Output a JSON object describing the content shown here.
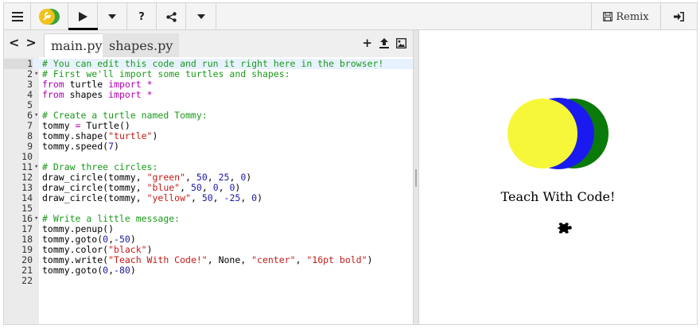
{
  "toolbar": {
    "remix_label": "Remix"
  },
  "editor": {
    "tabs": [
      {
        "label": "main.py"
      },
      {
        "label": "shapes.py"
      }
    ],
    "lines": [
      {
        "n": "1",
        "fold": "",
        "tokens": [
          [
            "c-com",
            "# You can edit this code and run it right here in the browser!"
          ]
        ]
      },
      {
        "n": "2",
        "fold": "▾",
        "tokens": [
          [
            "c-com",
            "# First we'll import some turtles and shapes:"
          ]
        ]
      },
      {
        "n": "3",
        "fold": "",
        "tokens": [
          [
            "c-kw",
            "from"
          ],
          [
            "",
            " turtle "
          ],
          [
            "c-kw",
            "import"
          ],
          [
            "",
            " "
          ],
          [
            "c-kw",
            "*"
          ]
        ]
      },
      {
        "n": "4",
        "fold": "",
        "tokens": [
          [
            "c-kw",
            "from"
          ],
          [
            "",
            " shapes "
          ],
          [
            "c-kw",
            "import"
          ],
          [
            "",
            " "
          ],
          [
            "c-kw",
            "*"
          ]
        ]
      },
      {
        "n": "5",
        "fold": "",
        "tokens": []
      },
      {
        "n": "6",
        "fold": "▾",
        "tokens": [
          [
            "c-com",
            "# Create a turtle named Tommy:"
          ]
        ]
      },
      {
        "n": "7",
        "fold": "",
        "tokens": [
          [
            "",
            "tommy "
          ],
          [
            "c-kw",
            "="
          ],
          [
            "",
            " Turtle()"
          ]
        ]
      },
      {
        "n": "8",
        "fold": "",
        "tokens": [
          [
            "",
            "tommy.shape("
          ],
          [
            "c-str",
            "\"turtle\""
          ],
          [
            "",
            ")"
          ]
        ]
      },
      {
        "n": "9",
        "fold": "",
        "tokens": [
          [
            "",
            "tommy.speed("
          ],
          [
            "c-num",
            "7"
          ],
          [
            "",
            ")"
          ]
        ]
      },
      {
        "n": "10",
        "fold": "",
        "tokens": []
      },
      {
        "n": "11",
        "fold": "▾",
        "tokens": [
          [
            "c-com",
            "# Draw three circles:"
          ]
        ]
      },
      {
        "n": "12",
        "fold": "",
        "tokens": [
          [
            "",
            "draw_circle(tommy, "
          ],
          [
            "c-str",
            "\"green\""
          ],
          [
            "",
            ", "
          ],
          [
            "c-num",
            "50"
          ],
          [
            "",
            ", "
          ],
          [
            "c-num",
            "25"
          ],
          [
            "",
            ", "
          ],
          [
            "c-num",
            "0"
          ],
          [
            "",
            ")"
          ]
        ]
      },
      {
        "n": "13",
        "fold": "",
        "tokens": [
          [
            "",
            "draw_circle(tommy, "
          ],
          [
            "c-str",
            "\"blue\""
          ],
          [
            "",
            ", "
          ],
          [
            "c-num",
            "50"
          ],
          [
            "",
            ", "
          ],
          [
            "c-num",
            "0"
          ],
          [
            "",
            ", "
          ],
          [
            "c-num",
            "0"
          ],
          [
            "",
            ")"
          ]
        ]
      },
      {
        "n": "14",
        "fold": "",
        "tokens": [
          [
            "",
            "draw_circle(tommy, "
          ],
          [
            "c-str",
            "\"yellow\""
          ],
          [
            "",
            ", "
          ],
          [
            "c-num",
            "50"
          ],
          [
            "",
            ", "
          ],
          [
            "c-num",
            "-25"
          ],
          [
            "",
            ", "
          ],
          [
            "c-num",
            "0"
          ],
          [
            "",
            ")"
          ]
        ]
      },
      {
        "n": "15",
        "fold": "",
        "tokens": []
      },
      {
        "n": "16",
        "fold": "▾",
        "tokens": [
          [
            "c-com",
            "# Write a little message:"
          ]
        ]
      },
      {
        "n": "17",
        "fold": "",
        "tokens": [
          [
            "",
            "tommy.penup()"
          ]
        ]
      },
      {
        "n": "18",
        "fold": "",
        "tokens": [
          [
            "",
            "tommy.goto("
          ],
          [
            "c-num",
            "0"
          ],
          [
            "",
            ","
          ],
          [
            "c-num",
            "-50"
          ],
          [
            "",
            ")"
          ]
        ]
      },
      {
        "n": "19",
        "fold": "",
        "tokens": [
          [
            "",
            "tommy.color("
          ],
          [
            "c-str",
            "\"black\""
          ],
          [
            "",
            ")"
          ]
        ]
      },
      {
        "n": "20",
        "fold": "",
        "tokens": [
          [
            "",
            "tommy.write("
          ],
          [
            "c-str",
            "\"Teach With Code!\""
          ],
          [
            "",
            ", None, "
          ],
          [
            "c-str",
            "\"center\""
          ],
          [
            "",
            ", "
          ],
          [
            "c-str",
            "\"16pt bold\""
          ],
          [
            "",
            ")"
          ]
        ]
      },
      {
        "n": "21",
        "fold": "",
        "tokens": [
          [
            "",
            "tommy.goto("
          ],
          [
            "c-num",
            "0"
          ],
          [
            "",
            ","
          ],
          [
            "c-num",
            "-80"
          ],
          [
            "",
            ")"
          ]
        ]
      },
      {
        "n": "22",
        "fold": "",
        "tokens": []
      }
    ]
  },
  "canvas": {
    "message": "Teach With Code!",
    "circles": [
      {
        "color": "#0a7a0a"
      },
      {
        "color": "#1a1af0"
      },
      {
        "color": "#f7f73a"
      }
    ]
  }
}
